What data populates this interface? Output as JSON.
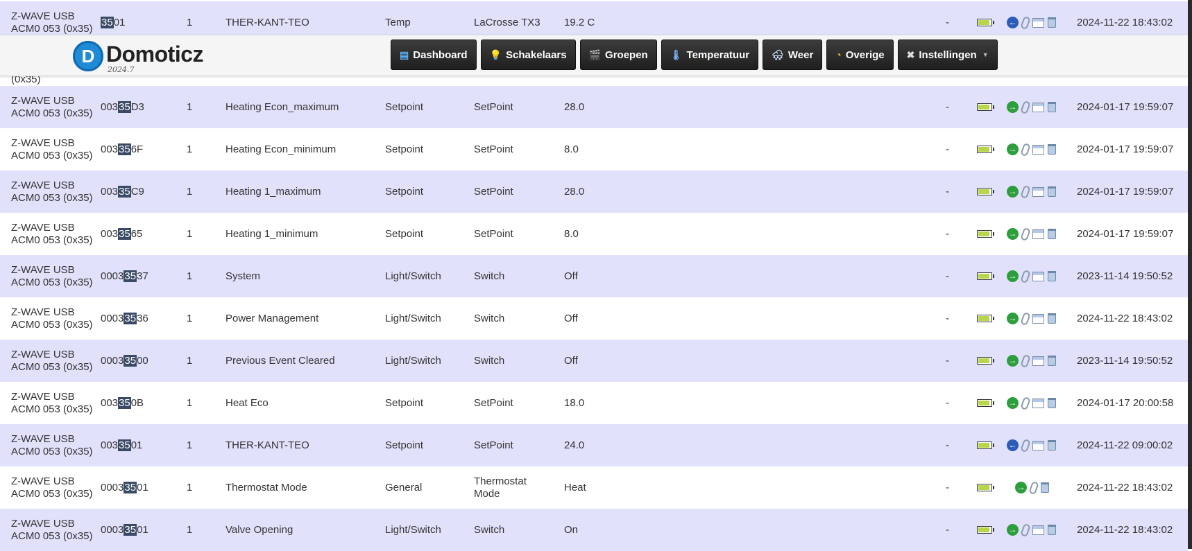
{
  "header": {
    "logo_letter": "D",
    "app_name": "Domoticz",
    "version": "2024.7",
    "nav": [
      {
        "label": "Dashboard",
        "icon": "dashboard-icon",
        "glyph": "▤",
        "color": "#5ab0f0"
      },
      {
        "label": "Schakelaars",
        "icon": "lightbulb-icon",
        "glyph": "💡",
        "color": "#ffe066"
      },
      {
        "label": "Groepen",
        "icon": "clapperboard-icon",
        "glyph": "🎬",
        "color": "#8fc8ff"
      },
      {
        "label": "Temperatuur",
        "icon": "thermometer-icon",
        "glyph": "🌡",
        "color": "#7fb6ff"
      },
      {
        "label": "Weer",
        "icon": "weather-icon",
        "glyph": "🌨",
        "color": "#cfe6ff"
      },
      {
        "label": "Overige",
        "icon": "gauge-icon",
        "glyph": "◔",
        "color": "#f7c04a"
      },
      {
        "label": "Instellingen",
        "icon": "tools-icon",
        "glyph": "✖",
        "color": "#dddddd",
        "dropdown": true
      }
    ]
  },
  "highlight": "35",
  "rows": [
    {
      "hw": "Z-WAVE USB ACM0 053 (0x35)",
      "id_pre": "",
      "id_post": "01",
      "unit": "1",
      "name": "THER-KANT-TEO",
      "type": "Temp",
      "subtype": "LaCrosse TX3",
      "data": "19.2 C",
      "dash": "-",
      "battery": 0.9,
      "action": "blue",
      "edit": true,
      "log": true,
      "delete": true,
      "last_seen": "2024-11-22 18:43:02"
    },
    {
      "hw": "",
      "id_pre": "",
      "id_post": "",
      "unit": "",
      "name": "",
      "type": "",
      "subtype": "",
      "data": "",
      "dash": "",
      "battery": null,
      "action": null,
      "edit": false,
      "log": false,
      "delete": false,
      "last_seen": "",
      "partial": true,
      "partial_text": "(0x35)"
    },
    {
      "hw": "Z-WAVE USB ACM0 053 (0x35)",
      "id_pre": "003",
      "id_post": "D3",
      "unit": "1",
      "name": "Heating Econ_maximum",
      "type": "Setpoint",
      "subtype": "SetPoint",
      "data": "28.0",
      "dash": "-",
      "battery": 0.9,
      "action": "green",
      "edit": true,
      "log": true,
      "delete": true,
      "last_seen": "2024-01-17 19:59:07"
    },
    {
      "hw": "Z-WAVE USB ACM0 053 (0x35)",
      "id_pre": "003",
      "id_post": "6F",
      "unit": "1",
      "name": "Heating Econ_minimum",
      "type": "Setpoint",
      "subtype": "SetPoint",
      "data": "8.0",
      "dash": "-",
      "battery": 0.9,
      "action": "green",
      "edit": true,
      "log": true,
      "delete": true,
      "last_seen": "2024-01-17 19:59:07"
    },
    {
      "hw": "Z-WAVE USB ACM0 053 (0x35)",
      "id_pre": "003",
      "id_post": "C9",
      "unit": "1",
      "name": "Heating 1_maximum",
      "type": "Setpoint",
      "subtype": "SetPoint",
      "data": "28.0",
      "dash": "-",
      "battery": 0.9,
      "action": "green",
      "edit": true,
      "log": true,
      "delete": true,
      "last_seen": "2024-01-17 19:59:07"
    },
    {
      "hw": "Z-WAVE USB ACM0 053 (0x35)",
      "id_pre": "003",
      "id_post": "65",
      "unit": "1",
      "name": "Heating 1_minimum",
      "type": "Setpoint",
      "subtype": "SetPoint",
      "data": "8.0",
      "dash": "-",
      "battery": 0.9,
      "action": "green",
      "edit": true,
      "log": true,
      "delete": true,
      "last_seen": "2024-01-17 19:59:07"
    },
    {
      "hw": "Z-WAVE USB ACM0 053 (0x35)",
      "id_pre": "0003",
      "id_post": "37",
      "unit": "1",
      "name": "System",
      "type": "Light/Switch",
      "subtype": "Switch",
      "data": "Off",
      "dash": "-",
      "battery": 0.9,
      "action": "green",
      "edit": true,
      "log": true,
      "delete": true,
      "last_seen": "2023-11-14 19:50:52"
    },
    {
      "hw": "Z-WAVE USB ACM0 053 (0x35)",
      "id_pre": "0003",
      "id_post": "36",
      "unit": "1",
      "name": "Power Management",
      "type": "Light/Switch",
      "subtype": "Switch",
      "data": "Off",
      "dash": "-",
      "battery": 0.9,
      "action": "green",
      "edit": true,
      "log": true,
      "delete": true,
      "last_seen": "2024-11-22 18:43:02"
    },
    {
      "hw": "Z-WAVE USB ACM0 053 (0x35)",
      "id_pre": "0003",
      "id_post": "00",
      "unit": "1",
      "name": "Previous Event Cleared",
      "type": "Light/Switch",
      "subtype": "Switch",
      "data": "Off",
      "dash": "-",
      "battery": 0.9,
      "action": "green",
      "edit": true,
      "log": true,
      "delete": true,
      "last_seen": "2023-11-14 19:50:52"
    },
    {
      "hw": "Z-WAVE USB ACM0 053 (0x35)",
      "id_pre": "003",
      "id_post": "0B",
      "unit": "1",
      "name": "Heat Eco",
      "type": "Setpoint",
      "subtype": "SetPoint",
      "data": "18.0",
      "dash": "-",
      "battery": 0.9,
      "action": "green",
      "edit": true,
      "log": true,
      "delete": true,
      "last_seen": "2024-01-17 20:00:58"
    },
    {
      "hw": "Z-WAVE USB ACM0 053 (0x35)",
      "id_pre": "003",
      "id_post": "01",
      "unit": "1",
      "name": "THER-KANT-TEO",
      "type": "Setpoint",
      "subtype": "SetPoint",
      "data": "24.0",
      "dash": "-",
      "battery": 0.9,
      "action": "blue",
      "edit": true,
      "log": true,
      "delete": true,
      "last_seen": "2024-11-22 09:00:02"
    },
    {
      "hw": "Z-WAVE USB ACM0 053 (0x35)",
      "id_pre": "0003",
      "id_post": "01",
      "unit": "1",
      "name": "Thermostat Mode",
      "type": "General",
      "subtype": "Thermostat Mode",
      "data": "Heat",
      "dash": "-",
      "battery": 0.9,
      "action": "green",
      "edit": true,
      "log": false,
      "delete": true,
      "last_seen": "2024-11-22 18:43:02"
    },
    {
      "hw": "Z-WAVE USB ACM0 053 (0x35)",
      "id_pre": "0003",
      "id_post": "01",
      "unit": "1",
      "name": "Valve Opening",
      "type": "Light/Switch",
      "subtype": "Switch",
      "data": "On",
      "dash": "-",
      "battery": 0.9,
      "action": "green",
      "edit": true,
      "log": true,
      "delete": true,
      "last_seen": "2024-11-22 18:43:02"
    }
  ],
  "colors": {
    "row_odd": "#e1e1fb",
    "row_even": "#ffffff",
    "highlight_bg": "#3a4a66",
    "battery_fill": "#b8d64a",
    "nav_bg": "#1f1f1f"
  }
}
